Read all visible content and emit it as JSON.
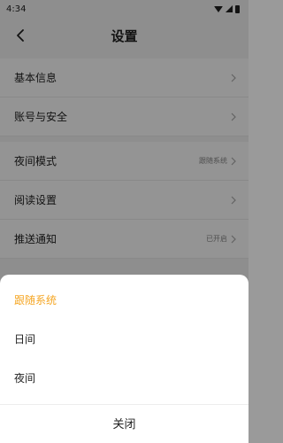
{
  "status_bar": {
    "time": "4:34"
  },
  "nav": {
    "title": "设置"
  },
  "settings": {
    "group1": [
      {
        "label": "基本信息",
        "value": ""
      },
      {
        "label": "账号与安全",
        "value": ""
      }
    ],
    "group2": [
      {
        "label": "夜间模式",
        "value": "跟随系统"
      },
      {
        "label": "阅读设置",
        "value": ""
      },
      {
        "label": "推送通知",
        "value": "已开启"
      }
    ]
  },
  "sheet": {
    "options": [
      "跟随系统",
      "日间",
      "夜间"
    ],
    "selected_index": 0,
    "close_label": "关闭",
    "accent_color": "#f5a623"
  }
}
